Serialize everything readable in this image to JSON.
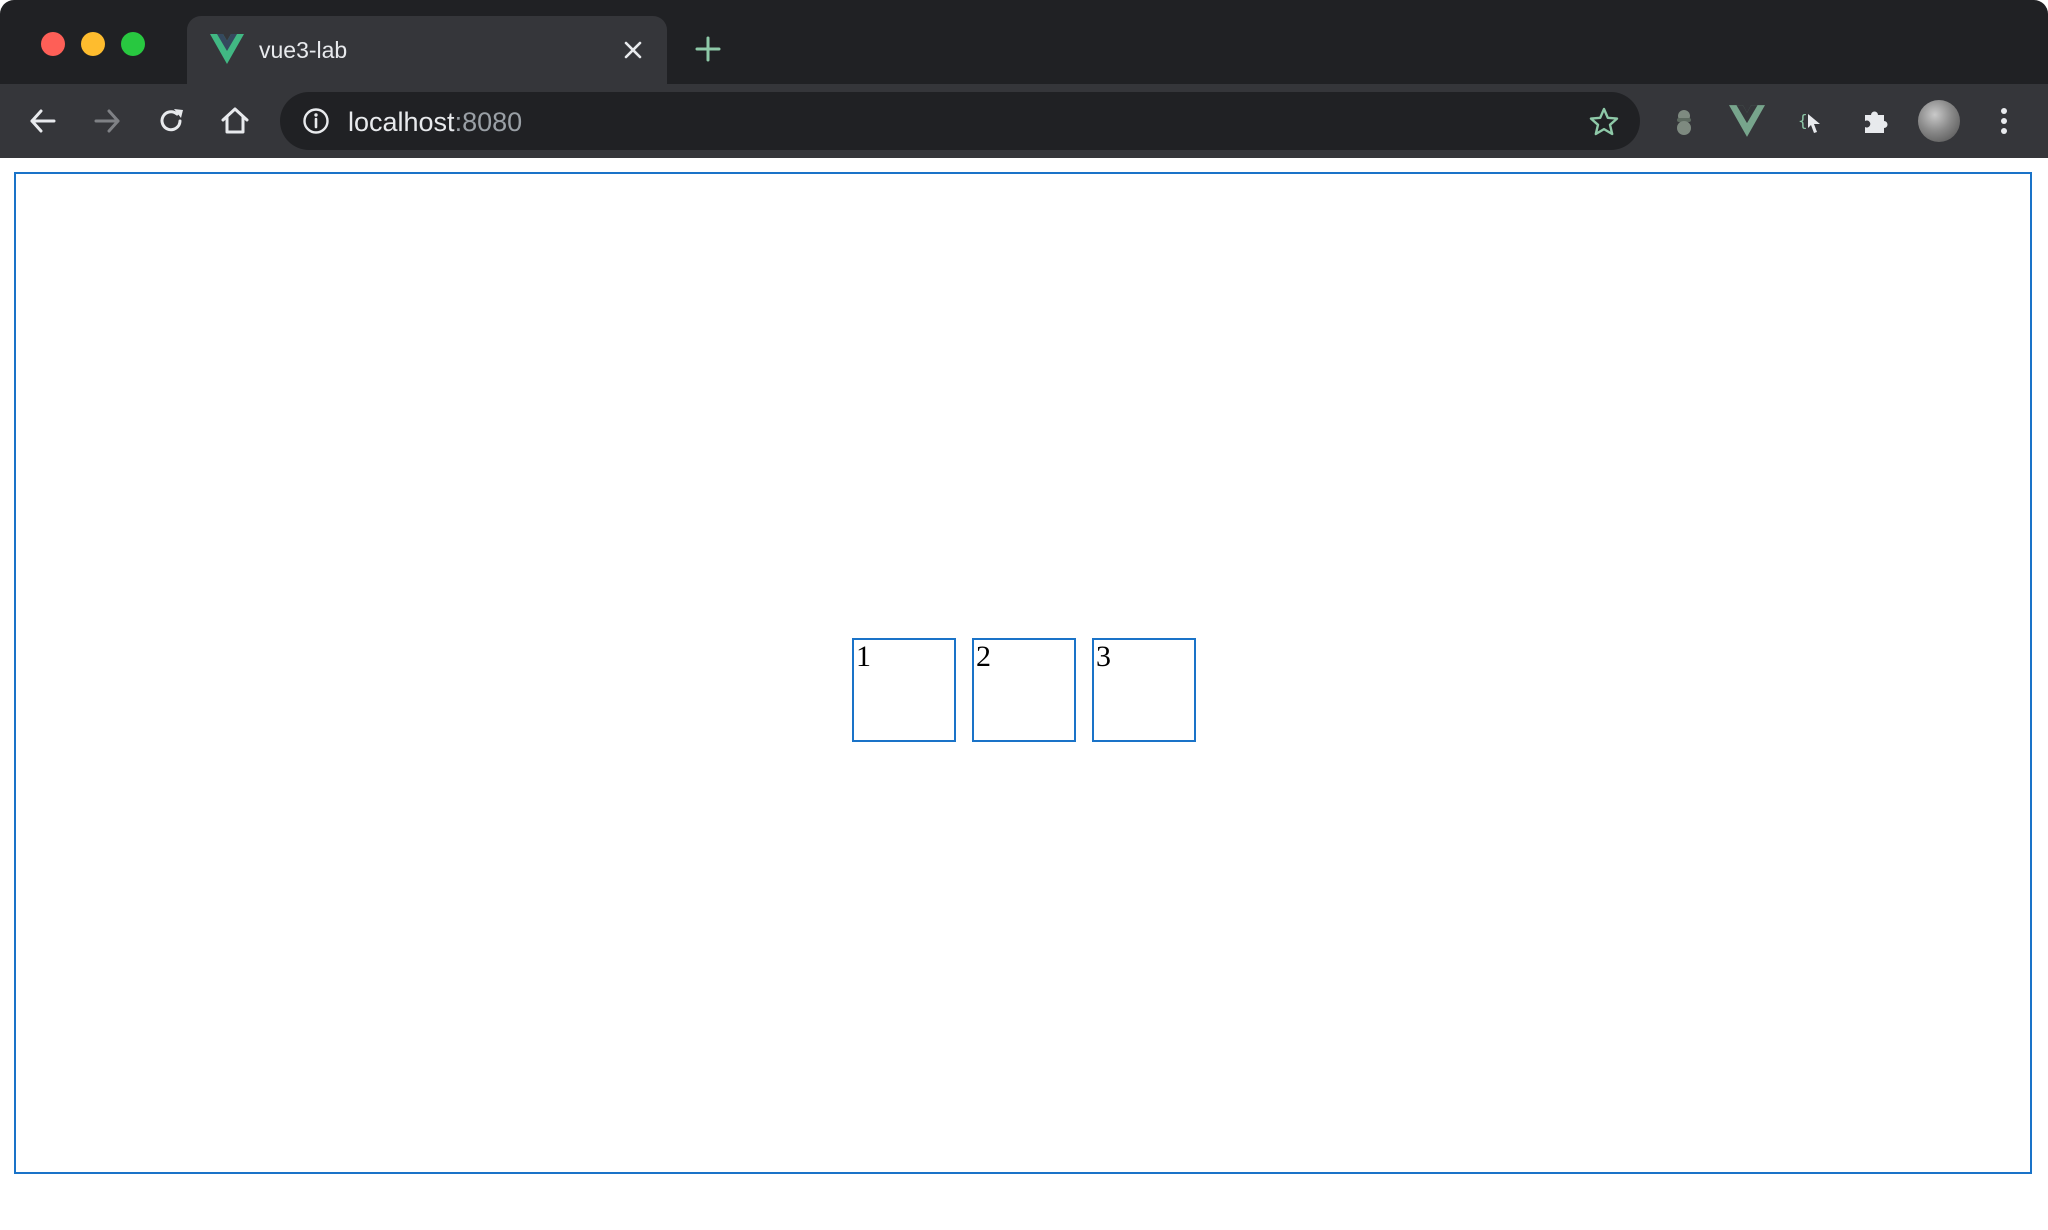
{
  "browser": {
    "tab": {
      "title": "vue3-lab",
      "favicon": "vue-logo-icon"
    },
    "address_bar": {
      "host": "localhost",
      "port": ":8080"
    },
    "extensions": [
      "incognito-spy-icon",
      "vue-devtools-icon",
      "selector-tool-icon",
      "puzzle-extensions-icon"
    ],
    "colors": {
      "chrome_dark": "#202124",
      "chrome_toolbar": "#35363a",
      "frame_border": "#1a73c8",
      "vue_green": "#41b883"
    }
  },
  "page": {
    "boxes": [
      {
        "label": "1"
      },
      {
        "label": "2"
      },
      {
        "label": "3"
      }
    ]
  }
}
